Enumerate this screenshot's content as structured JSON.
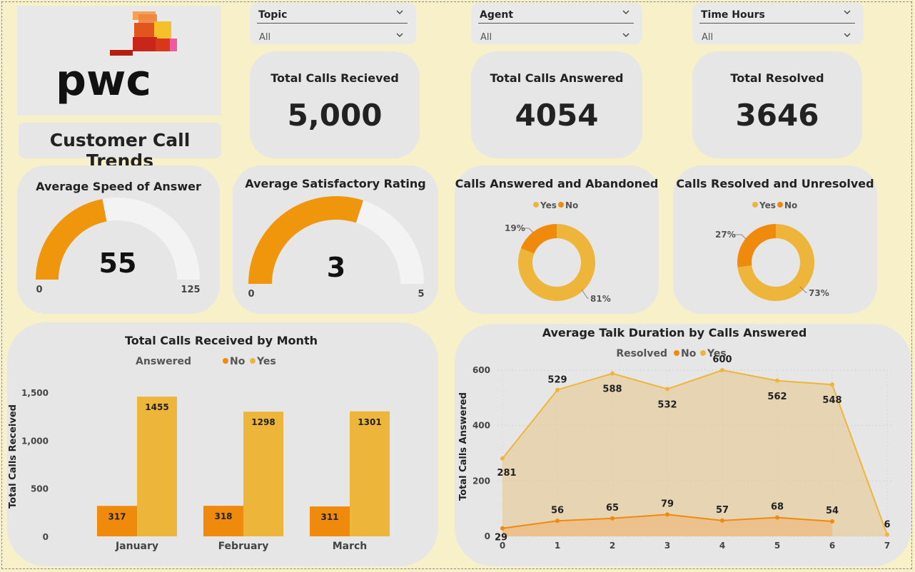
{
  "title": "Customer Call Trends",
  "logo": {
    "text": "pwc"
  },
  "colors": {
    "yes": "#eeb53b",
    "no": "#f08a0c",
    "gauge_fill": "#f0960c",
    "gauge_track": "#f3f3f3",
    "background": "#f8f0c8",
    "card": "#e6e6e6"
  },
  "slicers": [
    {
      "label": "Topic",
      "value": "All"
    },
    {
      "label": "Agent",
      "value": "All"
    },
    {
      "label": "Time Hours",
      "value": "All"
    }
  ],
  "kpis": {
    "received": {
      "label": "Total Calls Recieved",
      "value": "5,000"
    },
    "answered": {
      "label": "Total Calls Answered",
      "value": "4054"
    },
    "resolved": {
      "label": "Total Resolved",
      "value": "3646"
    }
  },
  "gauges": {
    "speed": {
      "title": "Average Speed of Answer",
      "value": "55",
      "min": "0",
      "max": "125",
      "fraction": 0.44
    },
    "rating": {
      "title": "Average Satisfactory Rating",
      "value": "3",
      "min": "0",
      "max": "5",
      "fraction": 0.6
    }
  },
  "donuts": {
    "abandoned": {
      "title": "Calls Answered and Abandoned",
      "legend_yes": "Yes",
      "legend_no": "No",
      "yes_pct": 81,
      "no_pct": 19,
      "yes_label": "81%",
      "no_label": "19%"
    },
    "resolved": {
      "title": "Calls Resolved and Unresolved",
      "legend_yes": "Yes",
      "legend_no": "No",
      "yes_pct": 73,
      "no_pct": 27,
      "yes_label": "73%",
      "no_label": "27%"
    }
  },
  "chart_data": [
    {
      "type": "bar",
      "title": "Total Calls Received by Month",
      "legend_title": "Answered",
      "ylabel": "Total Calls Received",
      "xlabel": "",
      "categories": [
        "January",
        "February",
        "March"
      ],
      "yticks": [
        "0",
        "500",
        "1,000",
        "1,500"
      ],
      "ylim": [
        0,
        1600
      ],
      "series": [
        {
          "name": "No",
          "values": [
            317,
            318,
            311
          ]
        },
        {
          "name": "Yes",
          "values": [
            1455,
            1298,
            1301
          ]
        }
      ],
      "legend_position": "top"
    },
    {
      "type": "area",
      "title": "Average Talk Duration by Calls Answered",
      "legend_title": "Resolved",
      "ylabel": "Total Calls Answered",
      "xlabel": "",
      "x": [
        0,
        1,
        2,
        3,
        4,
        5,
        6,
        7
      ],
      "yticks": [
        "0",
        "200",
        "400",
        "600"
      ],
      "ylim": [
        0,
        600
      ],
      "series": [
        {
          "name": "No",
          "x": [
            0,
            1,
            2,
            3,
            4,
            5,
            6
          ],
          "values": [
            29,
            56,
            65,
            79,
            57,
            68,
            54
          ]
        },
        {
          "name": "Yes",
          "x": [
            0,
            1,
            2,
            3,
            4,
            5,
            6,
            7
          ],
          "values": [
            281,
            529,
            588,
            532,
            600,
            562,
            548,
            6
          ]
        }
      ],
      "legend_position": "top"
    }
  ]
}
